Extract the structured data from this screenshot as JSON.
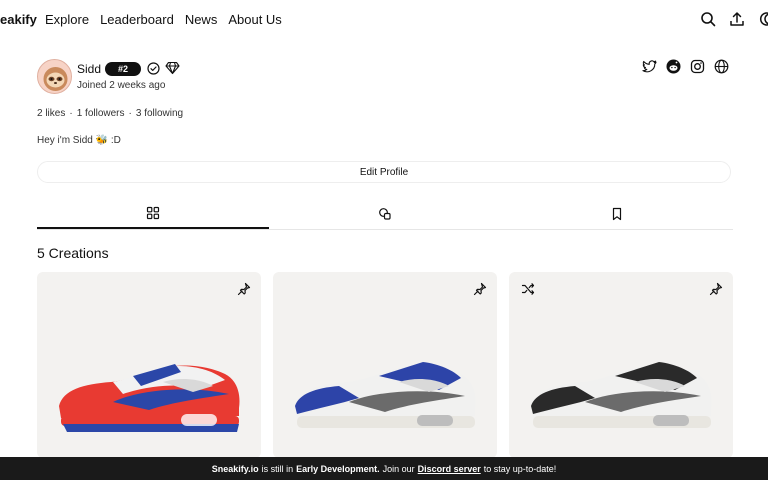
{
  "nav": {
    "brand": "eakify",
    "links": [
      "Explore",
      "Leaderboard",
      "News",
      "About Us"
    ]
  },
  "profile": {
    "username": "Sidd",
    "rank": "#2",
    "joined": "Joined 2 weeks ago",
    "stats": {
      "likes": "2 likes",
      "sep1": "·",
      "followers": "1 followers",
      "sep2": "·",
      "following": "3 following"
    },
    "bio": "Hey i'm Sidd 🐝 :D",
    "edit_label": "Edit Profile"
  },
  "creations": {
    "title": "5 Creations",
    "cards": [
      {
        "colors": {
          "primary": "#e83a32",
          "secondary": "#2b47a8",
          "panel": "#f2f2f2"
        }
      },
      {
        "colors": {
          "primary": "#f1f1f0",
          "secondary": "#2d44a8",
          "panel": "#6b6b6b"
        }
      },
      {
        "colors": {
          "primary": "#f1f1f0",
          "secondary": "#2a2a2a",
          "panel": "#6b6b6b"
        }
      }
    ]
  },
  "banner": {
    "site": "Sneakify.io",
    "text1": "is still in",
    "stage": "Early Development.",
    "text2": "Join our",
    "link": "Discord server",
    "text3": "to stay up-to-date!"
  }
}
